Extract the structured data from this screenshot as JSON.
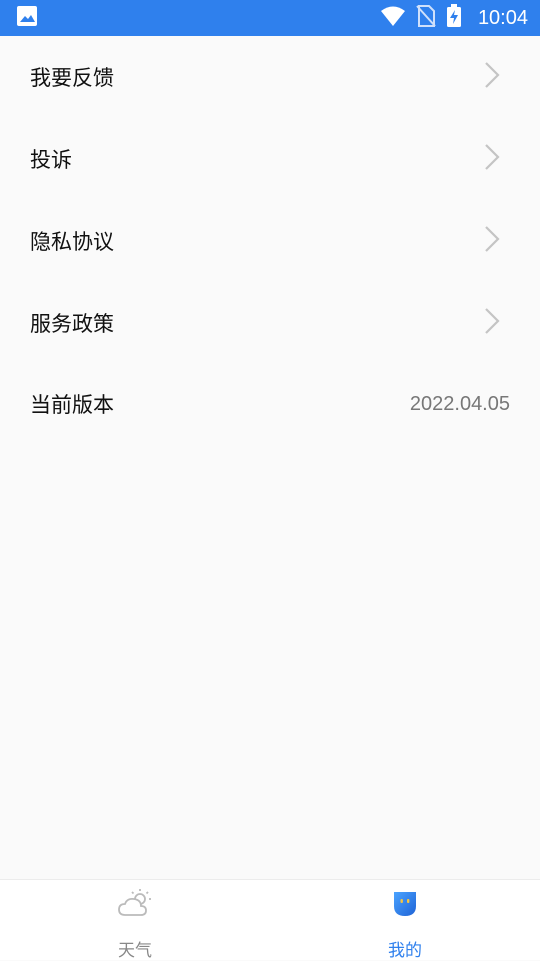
{
  "status_bar": {
    "time": "10:04",
    "icons": [
      "image-icon",
      "wifi-icon",
      "no-sim-icon",
      "battery-charging-icon"
    ],
    "color": "#2f80ed"
  },
  "menu": {
    "items": [
      {
        "label": "我要反馈",
        "icon": "chevron-right-icon"
      },
      {
        "label": "投诉",
        "icon": "chevron-right-icon"
      },
      {
        "label": "隐私协议",
        "icon": "chevron-right-icon"
      },
      {
        "label": "服务政策",
        "icon": "chevron-right-icon"
      }
    ],
    "version": {
      "label": "当前版本",
      "value": "2022.04.05"
    }
  },
  "tabbar": {
    "tabs": [
      {
        "label": "天气",
        "icon": "weather-cloud-sun-icon",
        "active": false
      },
      {
        "label": "我的",
        "icon": "mine-face-icon",
        "active": true
      }
    ],
    "active_color": "#2f80ed",
    "inactive_color": "#888888"
  }
}
